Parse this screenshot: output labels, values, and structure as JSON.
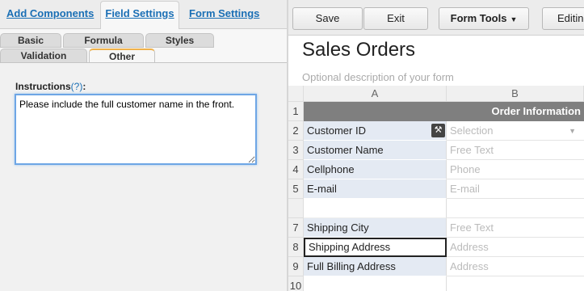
{
  "left_panel": {
    "top_tabs": [
      "Add Components",
      "Field Settings",
      "Form Settings"
    ],
    "sub_tabs": {
      "basic": "Basic",
      "formula": "Formula",
      "styles": "Styles",
      "validation": "Validation",
      "other": "Other"
    },
    "instructions": {
      "label": "Instructions",
      "help": "(?)",
      "suffix": ":",
      "value": "Please include the full customer name in the front."
    }
  },
  "toolbar": {
    "save": "Save",
    "exit": "Exit",
    "form_tools": "Form Tools",
    "editing": "Editing"
  },
  "form": {
    "title": "Sales Orders",
    "description": "Optional description of your form",
    "columns": [
      "A",
      "B"
    ],
    "header_text": "Order Information",
    "rows": [
      {
        "num": "1",
        "a": "",
        "b": "",
        "kind": "header"
      },
      {
        "num": "2",
        "a": "Customer ID",
        "b": "Selection",
        "kind": "field"
      },
      {
        "num": "3",
        "a": "Customer Name",
        "b": "Free Text",
        "kind": "field"
      },
      {
        "num": "4",
        "a": "Cellphone",
        "b": "Phone",
        "kind": "field"
      },
      {
        "num": "5",
        "a": "E-mail",
        "b": "E-mail",
        "kind": "field"
      },
      {
        "num": "",
        "a": "",
        "b": "",
        "kind": "empty"
      },
      {
        "num": "7",
        "a": "Shipping City",
        "b": "Free Text",
        "kind": "field"
      },
      {
        "num": "8",
        "a": "Shipping Address",
        "b": "Address",
        "kind": "selected"
      },
      {
        "num": "9",
        "a": "Full Billing Address",
        "b": "Address",
        "kind": "field"
      },
      {
        "num": "10",
        "a": "",
        "b": "",
        "kind": "empty"
      }
    ]
  }
}
